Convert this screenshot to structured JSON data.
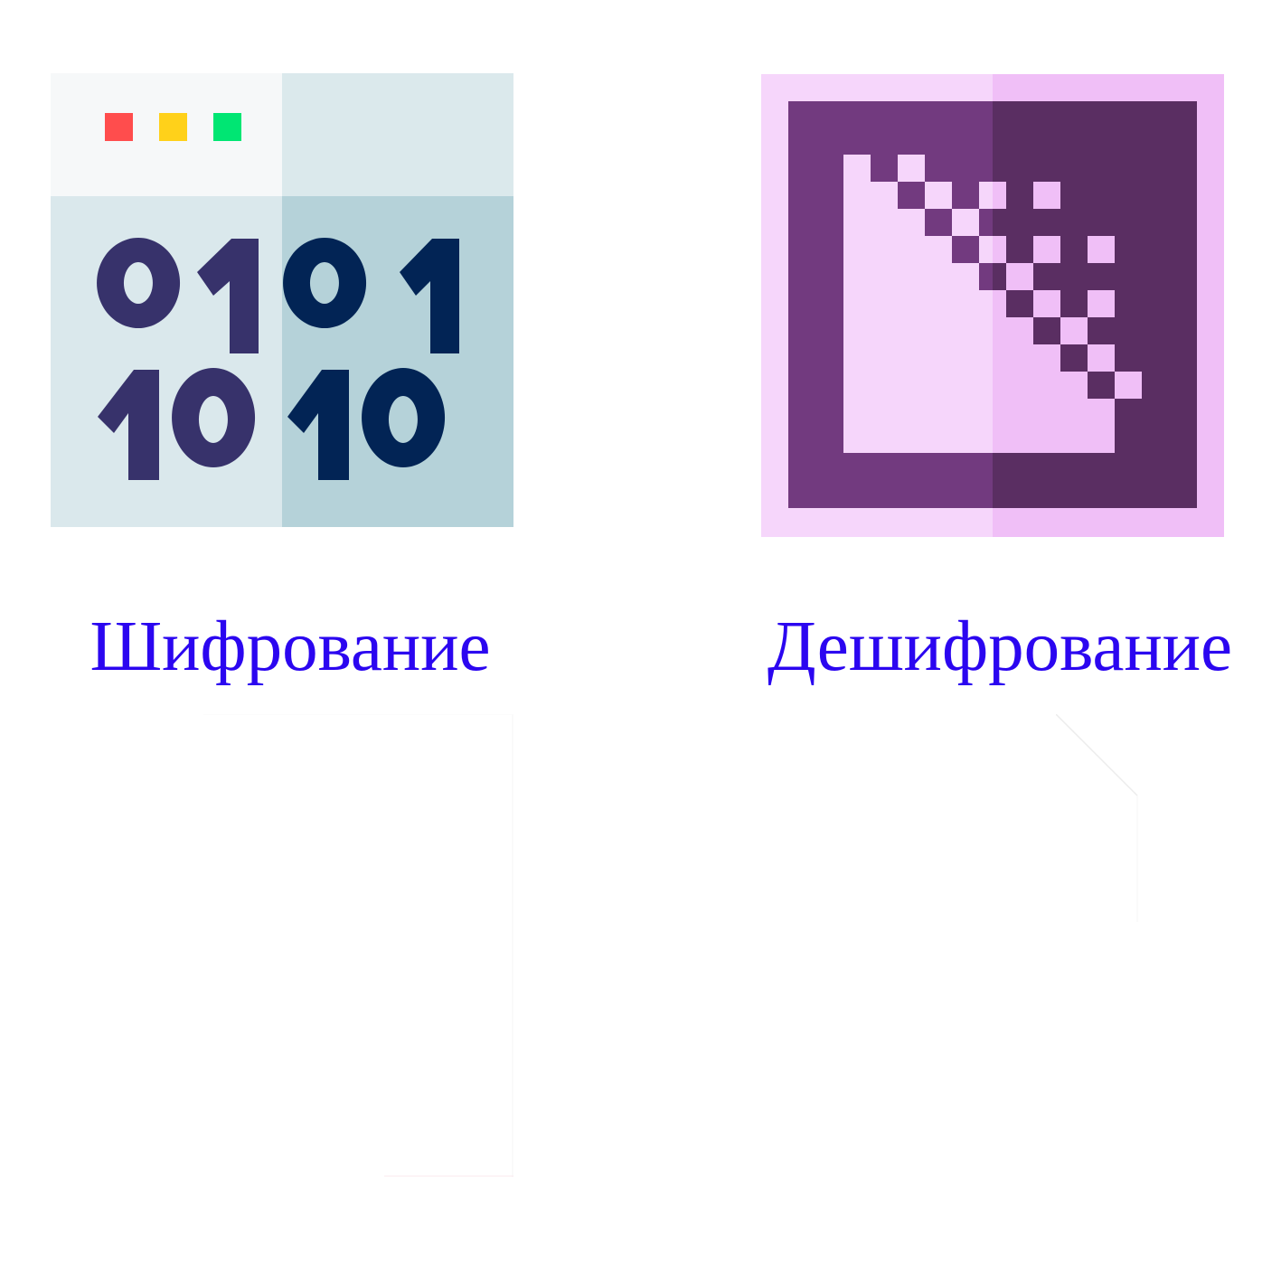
{
  "actions": [
    {
      "id": "encrypt",
      "label": "Шифрование",
      "icon": "binary-window-icon",
      "binary_lines": [
        "0101",
        "1010"
      ],
      "dots": [
        "#ff4d4d",
        "#ffd11a",
        "#00e673"
      ],
      "colors": {
        "titlebar_left": "#f6f8f9",
        "titlebar_right": "#dbe9ec",
        "body_left": "#dae8ec",
        "body_right": "#b5d2d9",
        "digits_left": "#37326b",
        "digits_right": "#022455"
      }
    },
    {
      "id": "decrypt",
      "label": "Дешифрование",
      "icon": "pixel-document-icon",
      "colors": {
        "frame_left": "#f6d6fb",
        "frame_right": "#f0bff7",
        "panel_left": "#723a7f",
        "panel_right": "#5a2e62"
      }
    }
  ],
  "accent_color": "#2b06f0"
}
